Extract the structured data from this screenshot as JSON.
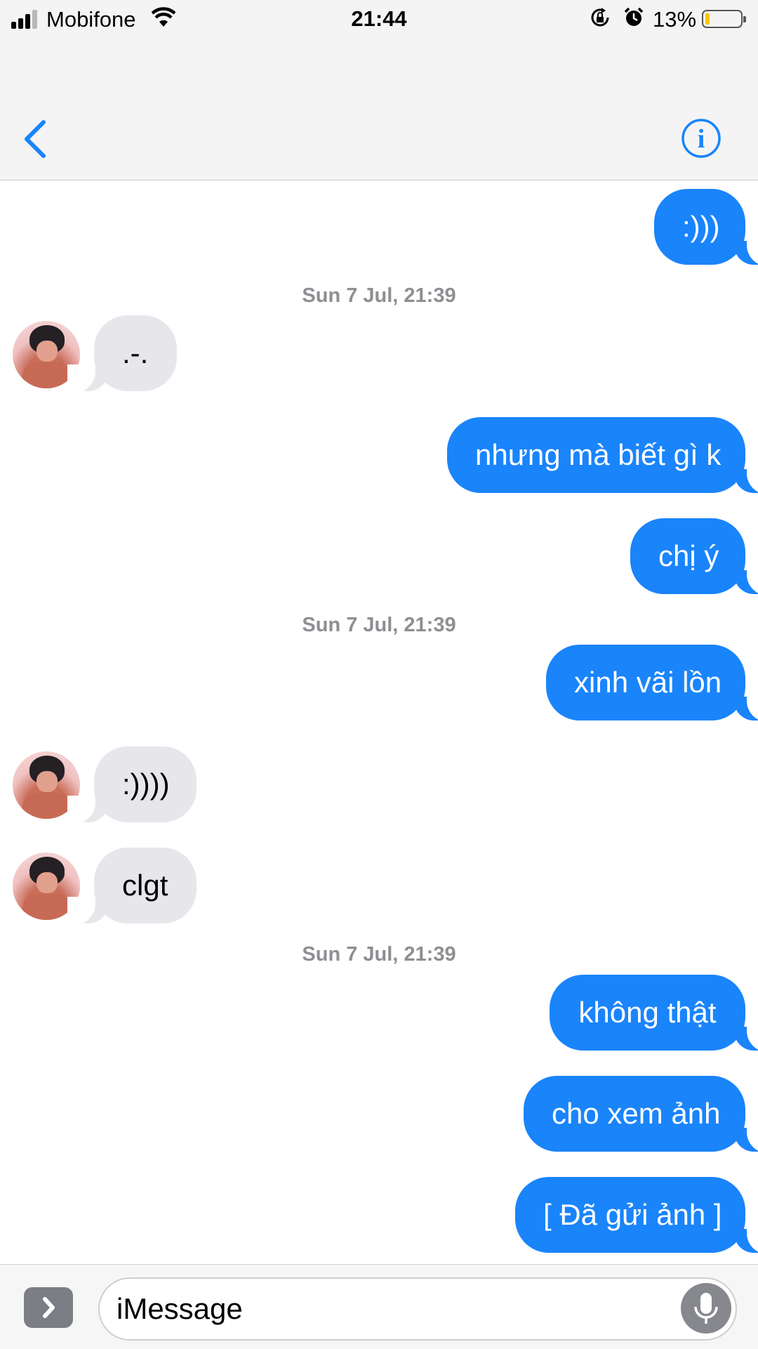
{
  "status_bar": {
    "carrier": "Mobifone",
    "time": "21:44",
    "battery_percent": "13%",
    "battery_level": 0.13,
    "battery_color": "#f6c700",
    "signal_bars": 4,
    "signal_bars_filled": 3
  },
  "nav": {
    "back_icon": "chevron-left-icon",
    "info_icon": "info-circle-icon",
    "accent_color": "#1a84fb"
  },
  "messages": [
    {
      "text": ":)))",
      "direction": "sent"
    },
    {
      "text": "Sun 7 Jul, 21:39",
      "direction": "timestamp"
    },
    {
      "text": ".-.",
      "direction": "received"
    },
    {
      "text": "nhưng mà biết gì k",
      "direction": "sent"
    },
    {
      "text": "chị ý",
      "direction": "sent"
    },
    {
      "text": "Sun 7 Jul, 21:39",
      "direction": "timestamp"
    },
    {
      "text": "xinh vãi lồn",
      "direction": "sent"
    },
    {
      "text": ":))))",
      "direction": "received"
    },
    {
      "text": "clgt",
      "direction": "received"
    },
    {
      "text": "Sun 7 Jul, 21:39",
      "direction": "timestamp"
    },
    {
      "text": "không thật",
      "direction": "sent"
    },
    {
      "text": "cho xem ảnh",
      "direction": "sent"
    },
    {
      "text": "[ Đã gửi ảnh ]",
      "direction": "sent"
    }
  ],
  "colors": {
    "sent_bubble": "#1a84fb",
    "received_bubble": "#e6e6eb",
    "timestamp": "#8e8e93"
  },
  "composer": {
    "placeholder": "iMessage",
    "apps_icon": "chevron-right-icon",
    "mic_icon": "microphone-icon"
  }
}
